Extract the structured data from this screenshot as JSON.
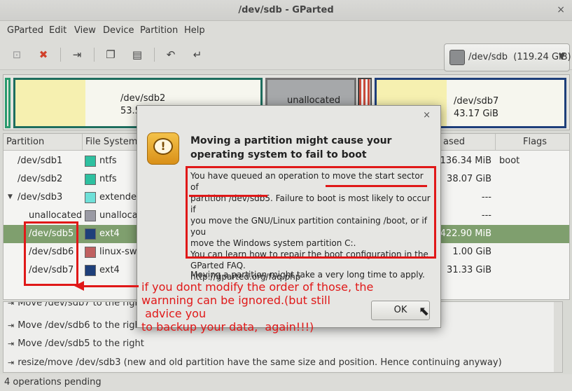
{
  "window": {
    "title": "/dev/sdb - GParted",
    "close_glyph": "×"
  },
  "menu": [
    "GParted",
    "Edit",
    "View",
    "Device",
    "Partition",
    "Help"
  ],
  "toolbar": {
    "device": "/dev/sdb",
    "device_size": "(119.24 GiB)",
    "buttons": [
      "new-icon",
      "delete-icon",
      "resize-move-icon",
      "copy-icon",
      "paste-icon",
      "undo-icon",
      "apply-icon"
    ]
  },
  "diskmap": {
    "sdb2_name": "/dev/sdb2",
    "sdb2_size": "53.5",
    "unalloc_name": "unallocated",
    "sdb7_name": "/dev/sdb7",
    "sdb7_size": "43.17 GiB"
  },
  "table": {
    "headers": [
      "Partition",
      "File System",
      "ased",
      "Flags"
    ],
    "rows": [
      {
        "partition": "/dev/sdb1",
        "fs": "ntfs",
        "used": "136.34 MiB",
        "flags": "boot",
        "color": "#2ec0a0"
      },
      {
        "partition": "/dev/sdb2",
        "fs": "ntfs",
        "used": "38.07 GiB",
        "flags": "",
        "color": "#2ec0a0"
      },
      {
        "partition": "/dev/sdb3",
        "fs": "extende",
        "used": "---",
        "flags": "",
        "color": "#6fe0d8"
      },
      {
        "partition": "unallocated",
        "fs": "unalloca",
        "used": "---",
        "flags": "",
        "color": "#9a9aa4"
      },
      {
        "partition": "/dev/sdb5",
        "fs": "ext4",
        "used": "422.90 MiB",
        "flags": "",
        "color": "#1e3f7a"
      },
      {
        "partition": "/dev/sdb6",
        "fs": "linux-swa",
        "used": "1.00 GiB",
        "flags": "",
        "color": "#c06060"
      },
      {
        "partition": "/dev/sdb7",
        "fs": "ext4",
        "used": "31.33 GiB",
        "flags": "",
        "color": "#1e3f7a"
      }
    ]
  },
  "operations": {
    "items": [
      "Move /dev/sdb7 to the right",
      "Move /dev/sdb6 to the right",
      "Move /dev/sdb5 to the right",
      "resize/move /dev/sdb3 (new and old partition have the same size and position.  Hence continuing anyway)"
    ],
    "arrow_glyph": "⇥"
  },
  "status": "4 operations pending",
  "dialog": {
    "close_glyph": "×",
    "icon_glyph": "!",
    "heading": "Moving a partition might cause your operating system to fail to boot",
    "body_lines": [
      "You have queued an operation to move the start sector of",
      "partition /dev/sdb5.  Failure to boot is most likely to occur if",
      "you move the GNU/Linux partition containing /boot, or if you",
      "move the Windows system partition C:.",
      "You can learn how to repair the boot configuration in the",
      "GParted FAQ.",
      "http://gparted.org/faq.php"
    ],
    "note": "Moving a partition might take a very long time to apply.",
    "ok_label": "OK"
  },
  "annotation": {
    "lines": [
      "if you dont modify the order of those, the",
      "warnning can be ignored.(but still",
      " advice you",
      "to backup your data,  again!!!)"
    ],
    "color": "#e01818"
  }
}
